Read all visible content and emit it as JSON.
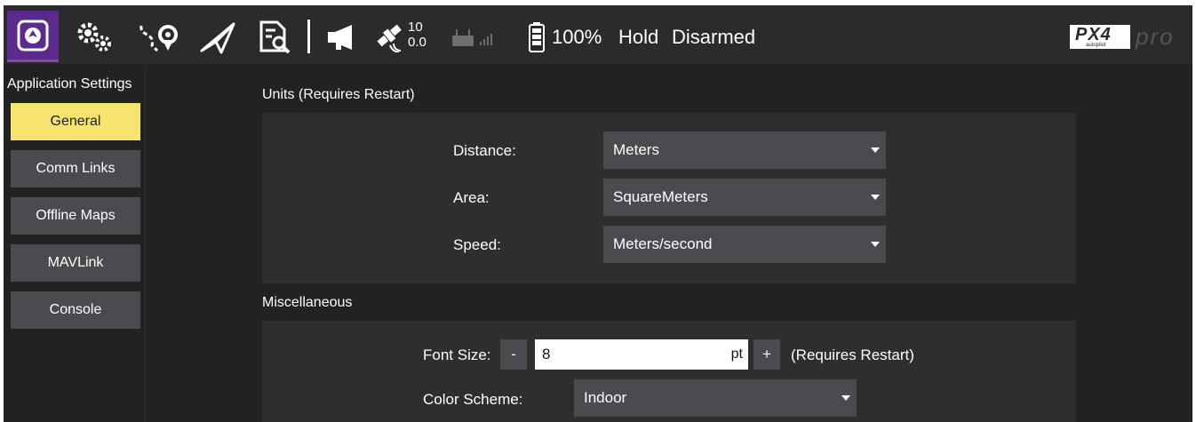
{
  "toolbar": {
    "icons": [
      "home-icon",
      "gears-icon",
      "route-icon",
      "paper-plane-icon",
      "document-search-icon",
      "megaphone-icon",
      "satellite-icon",
      "rc-icon",
      "signal-icon",
      "battery-icon"
    ],
    "satellite_count": "10",
    "hdop": "0.0",
    "battery": "100%",
    "flight_mode": "Hold",
    "arm_status": "Disarmed",
    "logo_text": "PX4",
    "logo_sub": "autopilot",
    "logo_pro": "pro"
  },
  "sidebar": {
    "title": "Application Settings",
    "items": [
      {
        "label": "General",
        "active": true
      },
      {
        "label": "Comm Links",
        "active": false
      },
      {
        "label": "Offline Maps",
        "active": false
      },
      {
        "label": "MAVLink",
        "active": false
      },
      {
        "label": "Console",
        "active": false
      }
    ]
  },
  "units": {
    "title": "Units (Requires Restart)",
    "distance_label": "Distance:",
    "distance_value": "Meters",
    "area_label": "Area:",
    "area_value": "SquareMeters",
    "speed_label": "Speed:",
    "speed_value": "Meters/second"
  },
  "misc": {
    "title": "Miscellaneous",
    "font_size_label": "Font Size:",
    "decrement": "-",
    "increment": "+",
    "font_size_value": "8",
    "font_size_unit": "pt",
    "font_size_note": "(Requires Restart)",
    "color_scheme_label": "Color Scheme:",
    "color_scheme_value": "Indoor"
  },
  "colors": {
    "toolbar_bg": "#2b2b2b",
    "page_bg": "#222222",
    "panel_bg": "#2e2e2e",
    "button_bg": "#4b4b4f",
    "active_button_bg": "#f7e46f",
    "home_bg": "#5a2a8c"
  }
}
